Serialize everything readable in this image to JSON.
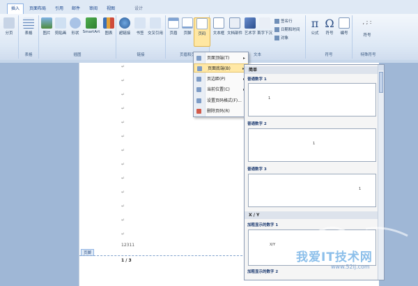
{
  "tabs": [
    {
      "label": "插入",
      "active": true
    },
    {
      "label": "页面布局"
    },
    {
      "label": "引用"
    },
    {
      "label": "邮件"
    },
    {
      "label": "审阅"
    },
    {
      "label": "视图"
    },
    {
      "label": "设计"
    }
  ],
  "ribbon": {
    "groups": [
      {
        "label": "",
        "buttons": [
          "分页"
        ]
      },
      {
        "label": "表格",
        "buttons": [
          "表格"
        ]
      },
      {
        "label": "插图",
        "buttons": [
          "图片",
          "剪贴画",
          "形状",
          "SmartArt",
          "图表"
        ]
      },
      {
        "label": "链接",
        "buttons": [
          "超链接",
          "书签",
          "交叉引用"
        ]
      },
      {
        "label": "页眉和页",
        "buttons": [
          "页眉",
          "页脚",
          "页码"
        ]
      },
      {
        "label": "文本",
        "buttons": [
          "文本框",
          "文档部件",
          "艺术字",
          "首字下沉"
        ],
        "small": [
          "签名行",
          "日期和时间",
          "对象"
        ]
      },
      {
        "label": "符号",
        "buttons": [
          "公式",
          "符号",
          "编号"
        ]
      },
      {
        "label": "特殊符号",
        "buttons": [
          "符号"
        ]
      }
    ]
  },
  "page_number_menu": {
    "items": [
      {
        "label": "页面顶端(T)",
        "has_submenu": true
      },
      {
        "label": "页面底端(B)",
        "has_submenu": true,
        "highlighted": true
      },
      {
        "label": "页边距(P)",
        "has_submenu": true
      },
      {
        "label": "当前位置(C)",
        "has_submenu": true
      },
      {
        "label": "设置页码格式(F)...",
        "has_submenu": false
      },
      {
        "label": "删除页码(R)",
        "has_submenu": false
      }
    ]
  },
  "gallery": {
    "section_simple": "简单",
    "items_simple": [
      {
        "name": "普通数字 1"
      },
      {
        "name": "普通数字 2"
      },
      {
        "name": "普通数字 3"
      }
    ],
    "section_xy": "X / Y",
    "items_xy": [
      {
        "name": "加粗显示的数字 1",
        "sample": "X/Y"
      },
      {
        "name": "加粗显示的数字 2"
      }
    ]
  },
  "document": {
    "footer_label": "页脚",
    "body_number": "12311",
    "footer_page": "1 / 3"
  },
  "watermark": {
    "brand": "我爱IT技术网",
    "url": "www.52ij.com"
  }
}
